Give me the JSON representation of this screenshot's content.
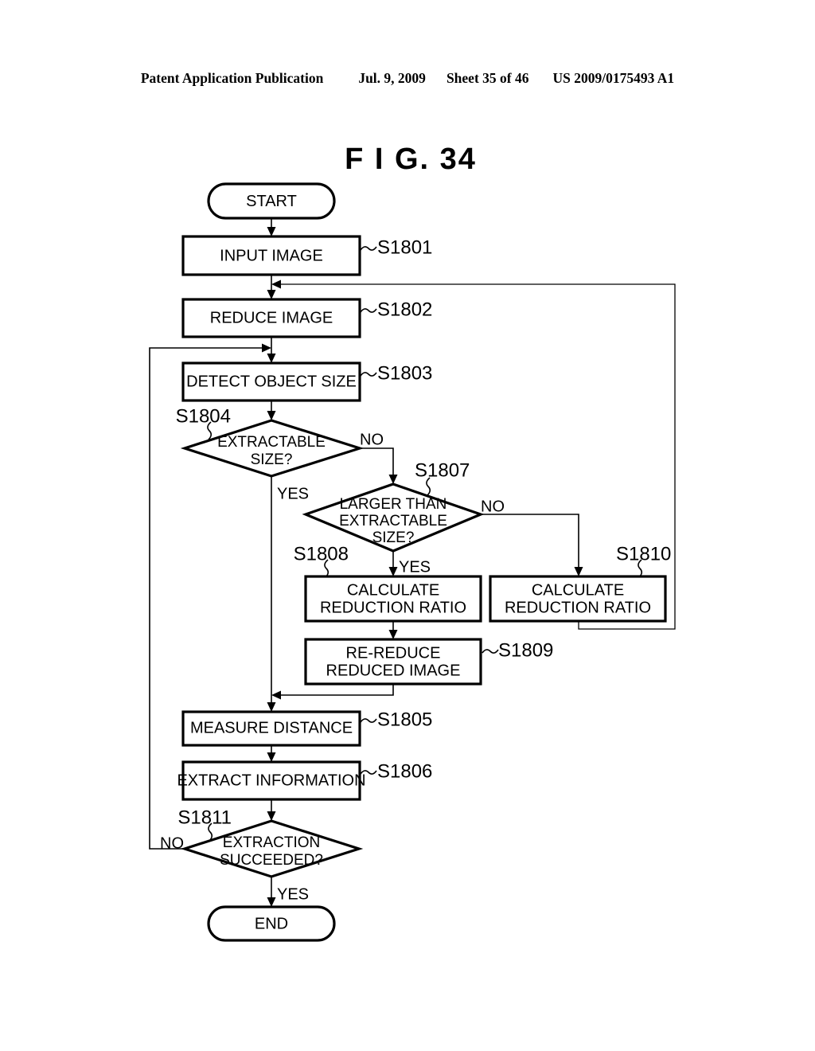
{
  "header": {
    "publication": "Patent Application Publication",
    "date": "Jul. 9, 2009",
    "sheet": "Sheet 35 of 46",
    "patent_number": "US 2009/0175493 A1"
  },
  "figure": {
    "title": "F I G.  34"
  },
  "flowchart": {
    "nodes": {
      "start": {
        "label": "START",
        "type": "terminator"
      },
      "s1801": {
        "label": "INPUT IMAGE",
        "step": "S1801",
        "type": "process"
      },
      "s1802": {
        "label": "REDUCE IMAGE",
        "step": "S1802",
        "type": "process"
      },
      "s1803": {
        "label": "DETECT OBJECT SIZE",
        "step": "S1803",
        "type": "process"
      },
      "s1804": {
        "line1": "EXTRACTABLE",
        "line2": "SIZE?",
        "step": "S1804",
        "type": "decision"
      },
      "s1807": {
        "line1": "LARGER THAN",
        "line2": "EXTRACTABLE",
        "line3": "SIZE?",
        "step": "S1807",
        "type": "decision"
      },
      "s1808": {
        "line1": "CALCULATE",
        "line2": "REDUCTION RATIO",
        "step": "S1808",
        "type": "process"
      },
      "s1810": {
        "line1": "CALCULATE",
        "line2": "REDUCTION RATIO",
        "step": "S1810",
        "type": "process"
      },
      "s1809": {
        "line1": "RE-REDUCE",
        "line2": "REDUCED IMAGE",
        "step": "S1809",
        "type": "process"
      },
      "s1805": {
        "label": "MEASURE DISTANCE",
        "step": "S1805",
        "type": "process"
      },
      "s1806": {
        "label": "EXTRACT INFORMATION",
        "step": "S1806",
        "type": "process"
      },
      "s1811": {
        "line1": "EXTRACTION",
        "line2": "SUCCEEDED?",
        "step": "S1811",
        "type": "decision"
      },
      "end": {
        "label": "END",
        "type": "terminator"
      }
    },
    "branch_labels": {
      "s1804_no": "NO",
      "s1804_yes": "YES",
      "s1807_no": "NO",
      "s1807_yes": "YES",
      "s1811_no": "NO",
      "s1811_yes": "YES"
    },
    "colors": {
      "stroke": "#000000",
      "fill": "#ffffff",
      "background": "#ffffff"
    }
  }
}
